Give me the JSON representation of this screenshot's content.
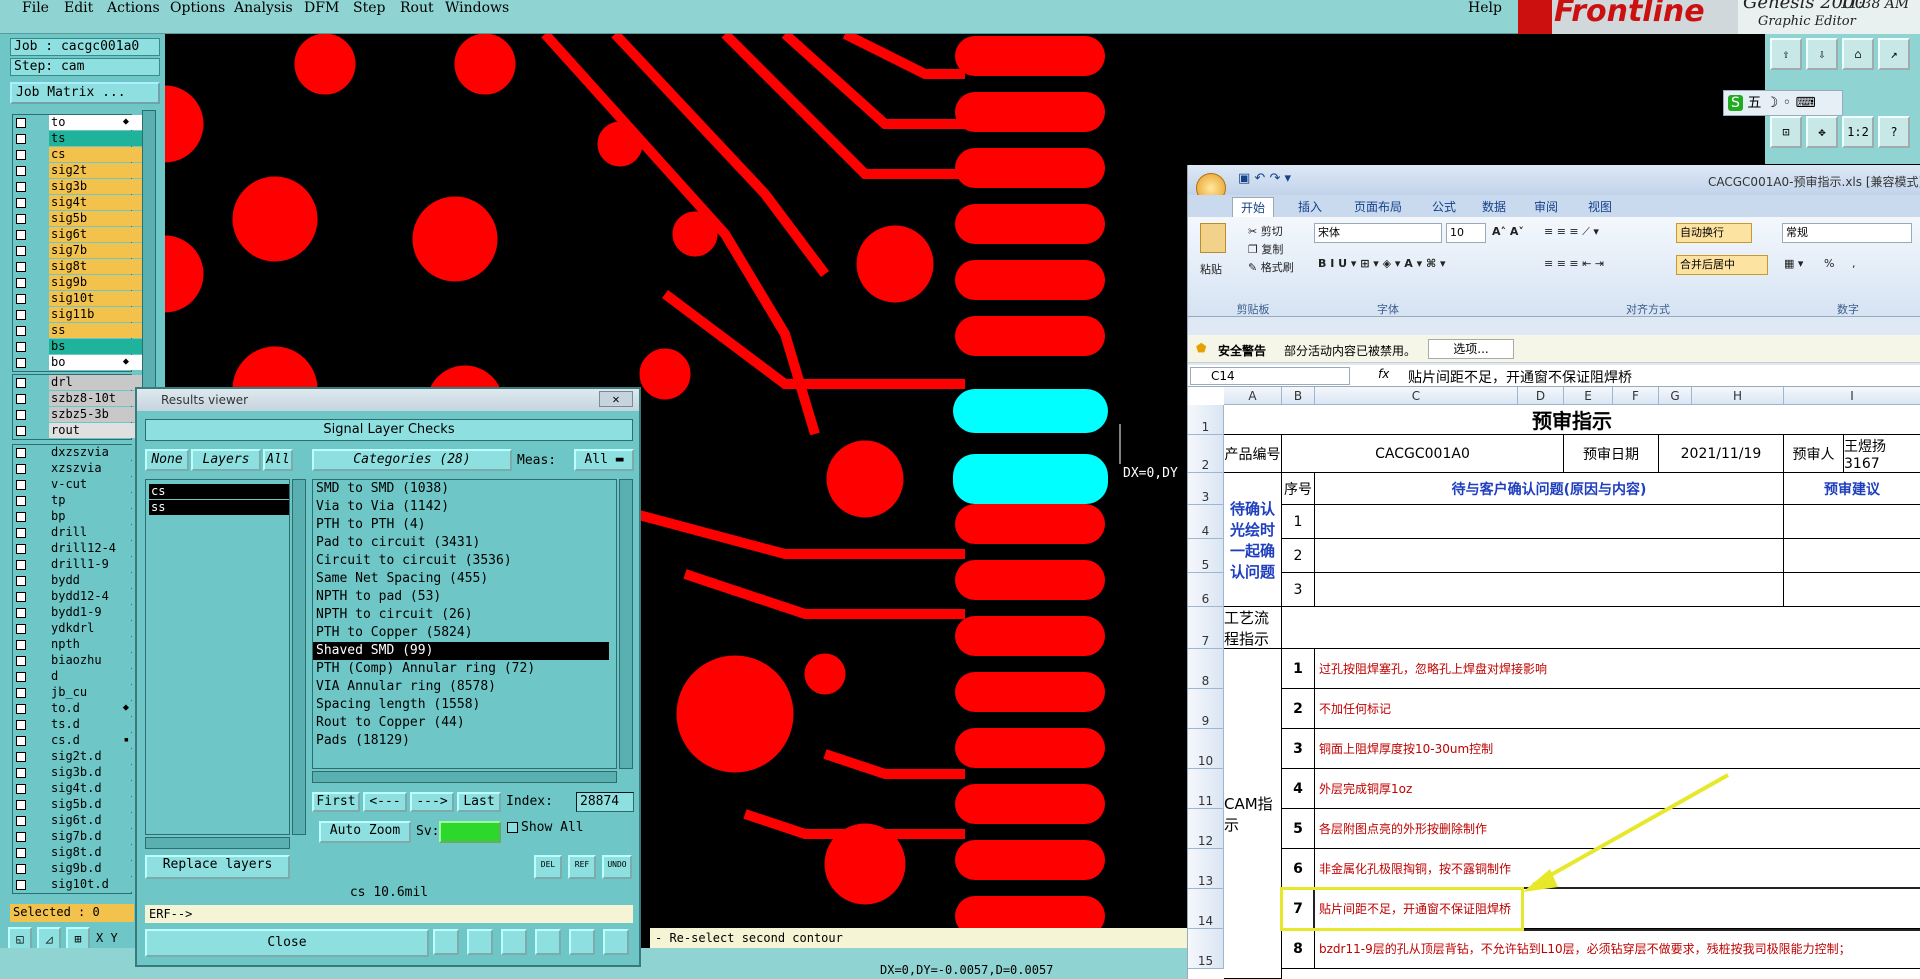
{
  "menu": [
    "File",
    "Edit",
    "Actions",
    "Options",
    "Analysis",
    "DFM",
    "Step",
    "Rout",
    "Windows"
  ],
  "help": "Help",
  "brand": {
    "logo": "Frontline",
    "product": "Genesis 2000",
    "subtitle": "Graphic Editor",
    "clock": "11:38 AM"
  },
  "job": {
    "job": "Job : cacgc001a0",
    "step": "Step: cam",
    "matrix": "Job Matrix ..."
  },
  "layers_group1": [
    {
      "name": "to",
      "color": "#ffffff",
      "mark": "⬥"
    },
    {
      "name": "ts",
      "color": "#1fb39b",
      "mark": ""
    },
    {
      "name": "cs",
      "color": "#f2c24c",
      "mark": ""
    },
    {
      "name": "sig2t",
      "color": "#f2c24c",
      "mark": ""
    },
    {
      "name": "sig3b",
      "color": "#f2c24c",
      "mark": ""
    },
    {
      "name": "sig4t",
      "color": "#f2c24c",
      "mark": ""
    },
    {
      "name": "sig5b",
      "color": "#f2c24c",
      "mark": ""
    },
    {
      "name": "sig6t",
      "color": "#f2c24c",
      "mark": ""
    },
    {
      "name": "sig7b",
      "color": "#f2c24c",
      "mark": ""
    },
    {
      "name": "sig8t",
      "color": "#f2c24c",
      "mark": ""
    },
    {
      "name": "sig9b",
      "color": "#f2c24c",
      "mark": ""
    },
    {
      "name": "sig10t",
      "color": "#f2c24c",
      "mark": ""
    },
    {
      "name": "sig11b",
      "color": "#f2c24c",
      "mark": ""
    },
    {
      "name": "ss",
      "color": "#f2c24c",
      "mark": ""
    },
    {
      "name": "bs",
      "color": "#1fb39b",
      "mark": ""
    },
    {
      "name": "bo",
      "color": "#ffffff",
      "mark": "⬥"
    }
  ],
  "layers_group2": [
    {
      "name": "drl",
      "color": "#c8c8c8",
      "mark": ""
    },
    {
      "name": "szbz8-10t",
      "color": "#c8c8c8",
      "mark": ""
    },
    {
      "name": "szbz5-3b",
      "color": "#c8c8c8",
      "mark": ""
    },
    {
      "name": "rout",
      "color": "#e0e0e0",
      "mark": ""
    }
  ],
  "layers_group3": [
    {
      "name": "dxzszvia",
      "color": "#6ec6c6",
      "mark": ""
    },
    {
      "name": "xzszvia",
      "color": "#6ec6c6",
      "mark": ""
    },
    {
      "name": "v-cut",
      "color": "#6ec6c6",
      "mark": ""
    },
    {
      "name": "tp",
      "color": "#6ec6c6",
      "mark": ""
    },
    {
      "name": "bp",
      "color": "#6ec6c6",
      "mark": ""
    },
    {
      "name": "drill",
      "color": "#6ec6c6",
      "mark": ""
    },
    {
      "name": "drill12-4",
      "color": "#6ec6c6",
      "mark": ""
    },
    {
      "name": "drill1-9",
      "color": "#6ec6c6",
      "mark": ""
    },
    {
      "name": "bydd",
      "color": "#6ec6c6",
      "mark": ""
    },
    {
      "name": "bydd12-4",
      "color": "#6ec6c6",
      "mark": ""
    },
    {
      "name": "bydd1-9",
      "color": "#6ec6c6",
      "mark": ""
    },
    {
      "name": "ydkdrl",
      "color": "#6ec6c6",
      "mark": ""
    },
    {
      "name": "npth",
      "color": "#6ec6c6",
      "mark": ""
    },
    {
      "name": "biaozhu",
      "color": "#6ec6c6",
      "mark": ""
    },
    {
      "name": "d",
      "color": "#6ec6c6",
      "mark": ""
    },
    {
      "name": "jb_cu",
      "color": "#6ec6c6",
      "mark": ""
    },
    {
      "name": "to.d",
      "color": "#6ec6c6",
      "mark": "⬥"
    },
    {
      "name": "ts.d",
      "color": "#6ec6c6",
      "mark": ""
    },
    {
      "name": "cs.d",
      "color": "#6ec6c6",
      "mark": "▪"
    },
    {
      "name": "sig2t.d",
      "color": "#6ec6c6",
      "mark": ""
    },
    {
      "name": "sig3b.d",
      "color": "#6ec6c6",
      "mark": ""
    },
    {
      "name": "sig4t.d",
      "color": "#6ec6c6",
      "mark": ""
    },
    {
      "name": "sig5b.d",
      "color": "#6ec6c6",
      "mark": ""
    },
    {
      "name": "sig6t.d",
      "color": "#6ec6c6",
      "mark": ""
    },
    {
      "name": "sig7b.d",
      "color": "#6ec6c6",
      "mark": ""
    },
    {
      "name": "sig8t.d",
      "color": "#6ec6c6",
      "mark": ""
    },
    {
      "name": "sig9b.d",
      "color": "#6ec6c6",
      "mark": ""
    },
    {
      "name": "sig10t.d",
      "color": "#6ec6c6",
      "mark": ""
    }
  ],
  "selected": "Selected : 0",
  "xy_label": "X Y",
  "canvas": {
    "dx_label": "DX=0,DY",
    "status": "- Re-select second contour",
    "readout": "DX=0,DY=-0.0057,D=0.0057",
    "trace_color": "#ff0000",
    "highlight_color": "#00ffff"
  },
  "results": {
    "title": "Results viewer",
    "close_x": "✕",
    "heading": "Signal Layer Checks",
    "none": "None",
    "layers": "Layers",
    "all": "All",
    "categories_btn": "Categories (28)",
    "meas_label": "Meas:",
    "meas_value": "All",
    "layers_list": [
      "cs",
      "ss"
    ],
    "categories": [
      "SMD to SMD (1038)",
      "Via to Via (1142)",
      "PTH to PTH (4)",
      "Pad to circuit (3431)",
      "Circuit to circuit (3536)",
      "Same Net Spacing (455)",
      "NPTH to pad (53)",
      "NPTH to circuit (26)",
      "PTH to Copper (5824)",
      "Shaved SMD (99)",
      "PTH (Comp) Annular ring (72)",
      "VIA Annular ring (8578)",
      "Spacing length (1558)",
      "Rout to Copper (44)",
      "Pads (18129)"
    ],
    "selected_category_index": 9,
    "first": "First",
    "prev": "<---",
    "next": "--->",
    "last": "Last",
    "index_label": "Index:",
    "index_value": "28874",
    "auto_zoom": "Auto Zoom",
    "sv_label": "Sv:",
    "show_all": "Show All",
    "replace_layers": "Replace layers",
    "del": "DEL",
    "ref": "REF",
    "undo": "UNDO",
    "cs_info": "cs 10.6mil",
    "erf": "ERF-->",
    "close": "Close"
  },
  "excel": {
    "title": "CACGC001A0-预审指示.xls [兼容模式]",
    "tabs": [
      "开始",
      "插入",
      "页面布局",
      "公式",
      "数据",
      "审阅",
      "视图"
    ],
    "clipboard": {
      "paste": "粘贴",
      "cut": "剪切",
      "copy": "复制",
      "format": "格式刷",
      "group": "剪贴板"
    },
    "font": {
      "name": "宋体",
      "size": "10",
      "group": "字体"
    },
    "align": {
      "wrap": "自动换行",
      "merge": "合并后居中",
      "group": "对齐方式"
    },
    "number": {
      "format": "常规",
      "percent": "%",
      "comma": ",",
      "group": "数字"
    },
    "security": {
      "label": "安全警告",
      "msg": "部分活动内容已被禁用。",
      "btn": "选项..."
    },
    "namebox": "C14",
    "fx": "fx",
    "formula": "贴片间距不足，开通窗不保证阻焊桥",
    "cols": [
      "A",
      "B",
      "C",
      "D",
      "E",
      "F",
      "G",
      "H",
      "I"
    ],
    "rows": [
      "1",
      "2",
      "3",
      "4",
      "5",
      "6",
      "7",
      "8",
      "9",
      "10",
      "11",
      "12",
      "13",
      "14",
      "15"
    ],
    "sheet": {
      "title": "预审指示",
      "product_label": "产品编号",
      "product": "CACGC001A0",
      "date_label": "预审日期",
      "date": "2021/11/19",
      "reviewer_label": "预审人",
      "reviewer": "王煜扬3167",
      "confirm_label": "待确认光绘时一起确认问题",
      "seq": "序号",
      "issue_head": "待与客户确认问题(原因与内容)",
      "advice_head": "预审建议",
      "flow_label": "工艺流程指示",
      "cam_label": "CAM指示",
      "items": [
        {
          "n": "1",
          "t": ""
        },
        {
          "n": "2",
          "t": ""
        },
        {
          "n": "3",
          "t": ""
        }
      ],
      "cam_items": [
        {
          "n": "1",
          "t": "过孔按阻焊塞孔，忽略孔上焊盘对焊接影响"
        },
        {
          "n": "2",
          "t": "不加任何标记"
        },
        {
          "n": "3",
          "t": "铜面上阻焊厚度按10-30um控制"
        },
        {
          "n": "4",
          "t": "外层完成铜厚1oz"
        },
        {
          "n": "5",
          "t": "各层附图点亮的外形按删除制作"
        },
        {
          "n": "6",
          "t": "非金属化孔极限掏铜，按不露铜制作"
        },
        {
          "n": "7",
          "t": "贴片间距不足，开通窗不保证阻焊桥"
        },
        {
          "n": "8",
          "t": "bzdr11-9层的孔从顶层背钻，不允许钻到L10层，必须钻穿层不做要求，残桩按我司极限能力控制；"
        }
      ]
    }
  }
}
